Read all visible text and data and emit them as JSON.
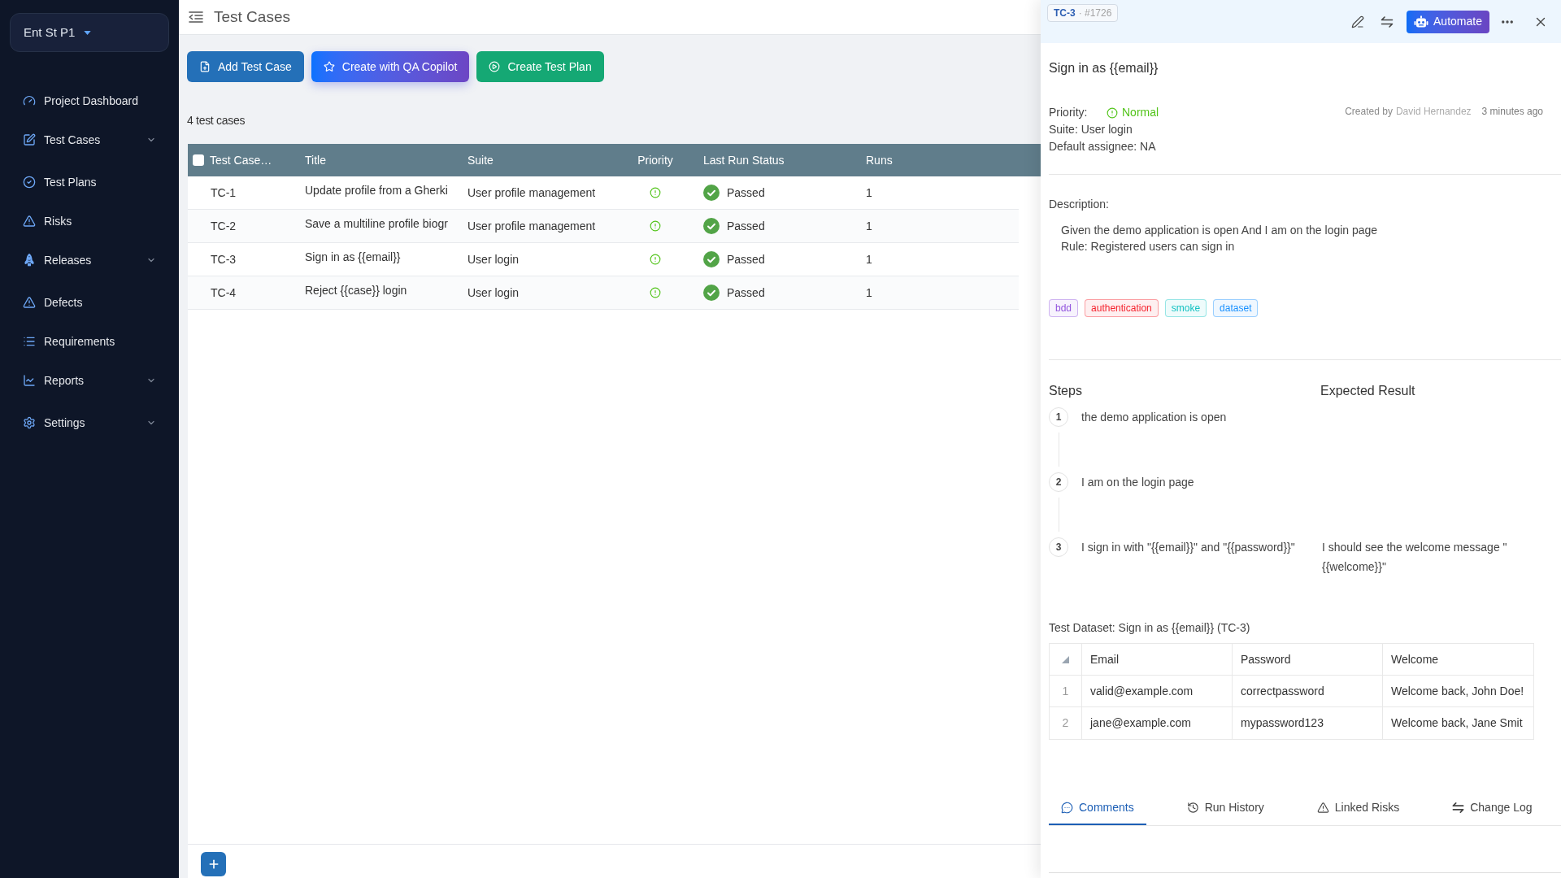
{
  "sidebar": {
    "project": "Ent St P1",
    "items": [
      {
        "label": "Project Dashboard",
        "has_submenu": false,
        "selected": false
      },
      {
        "label": "Test Cases",
        "has_submenu": true,
        "selected": false
      },
      {
        "label": "Test Plans",
        "has_submenu": false,
        "selected": false
      },
      {
        "label": "Risks",
        "has_submenu": false,
        "selected": false
      },
      {
        "label": "Releases",
        "has_submenu": true,
        "selected": false
      },
      {
        "label": "Defects",
        "has_submenu": false,
        "selected": false
      },
      {
        "label": "Requirements",
        "has_submenu": false,
        "selected": false
      },
      {
        "label": "Reports",
        "has_submenu": true,
        "selected": false
      },
      {
        "label": "Settings",
        "has_submenu": true,
        "selected": false
      }
    ]
  },
  "header": {
    "title": "Test Cases"
  },
  "actions": [
    {
      "label": "Add Test Case",
      "kind": "add"
    },
    {
      "label": "Create with QA Copilot",
      "kind": "copilot"
    },
    {
      "label": "Create Test Plan",
      "kind": "plan"
    }
  ],
  "count": "4 test cases",
  "table": {
    "select_all_checked": false,
    "columns": [
      "Test Case…",
      "Title",
      "Suite",
      "Priority",
      "Last Run Status",
      "Runs"
    ],
    "rows": [
      {
        "id": "TC-1",
        "title": "Update profile from a Gherki",
        "suite": "User profile management",
        "priority": {
          "kind": "normal"
        },
        "status": {
          "kind": "passed",
          "label": "Passed"
        },
        "runs": "1"
      },
      {
        "id": "TC-2",
        "title": "Save a multiline profile biogr",
        "suite": "User profile management",
        "priority": {
          "kind": "normal"
        },
        "status": {
          "kind": "passed",
          "label": "Passed"
        },
        "runs": "1"
      },
      {
        "id": "TC-3",
        "title": "Sign in as {{email}}",
        "suite": "User login",
        "priority": {
          "kind": "normal"
        },
        "status": {
          "kind": "passed",
          "label": "Passed"
        },
        "runs": "1"
      },
      {
        "id": "TC-4",
        "title": "Reject {{case}} login",
        "suite": "User login",
        "priority": {
          "kind": "normal"
        },
        "status": {
          "kind": "passed",
          "label": "Passed"
        },
        "runs": "1"
      }
    ]
  },
  "detail": {
    "case_id": "TC-3",
    "case_number": "· #1726",
    "automate_label": "Automate",
    "title": "Sign in as {{email}}",
    "priority_label": "Priority:",
    "priority": {
      "kind": "normal",
      "label": "Normal"
    },
    "created_by_label": "Created by",
    "author": "David Hernandez",
    "created": "3 minutes ago",
    "suite": "Suite: User login",
    "assignee": "Default assignee: NA",
    "description_label": "Description:",
    "description": [
      "Given the demo application is open And I am on the login page",
      "Rule: Registered users can sign in"
    ],
    "tags": [
      {
        "label": "bdd",
        "color": "#9254de"
      },
      {
        "label": "authentication",
        "color": "#f5222d"
      },
      {
        "label": "smoke",
        "color": "#13c2c2"
      },
      {
        "label": "dataset",
        "color": "#1890ff"
      }
    ],
    "steps_heading": "Steps",
    "expected_heading": "Expected Result",
    "steps": [
      {
        "number": "1",
        "action": "the demo application is open"
      },
      {
        "number": "2",
        "action": "I am on the login page"
      },
      {
        "number": "3",
        "action": "I sign in with \"{{email}}\" and \"{{password}}\"",
        "expected": "I should see the welcome message \" {{welcome}}\""
      }
    ],
    "dataset": {
      "title": "Test Dataset: Sign in as {{email}} (TC-3)",
      "columns": [
        "Email",
        "Password",
        "Welcome"
      ],
      "rows": [
        {
          "index": "1",
          "cells": [
            "valid@example.com",
            "correctpassword",
            "Welcome back, John Doe!"
          ]
        },
        {
          "index": "2",
          "cells": [
            "jane@example.com",
            "mypassword123",
            "Welcome back, Jane Smit"
          ]
        }
      ]
    },
    "tabs": [
      {
        "label": "Comments",
        "selected": true
      },
      {
        "label": "Run History",
        "selected": false
      },
      {
        "label": "Linked Risks",
        "selected": false
      },
      {
        "label": "Change Log",
        "selected": false
      }
    ]
  }
}
